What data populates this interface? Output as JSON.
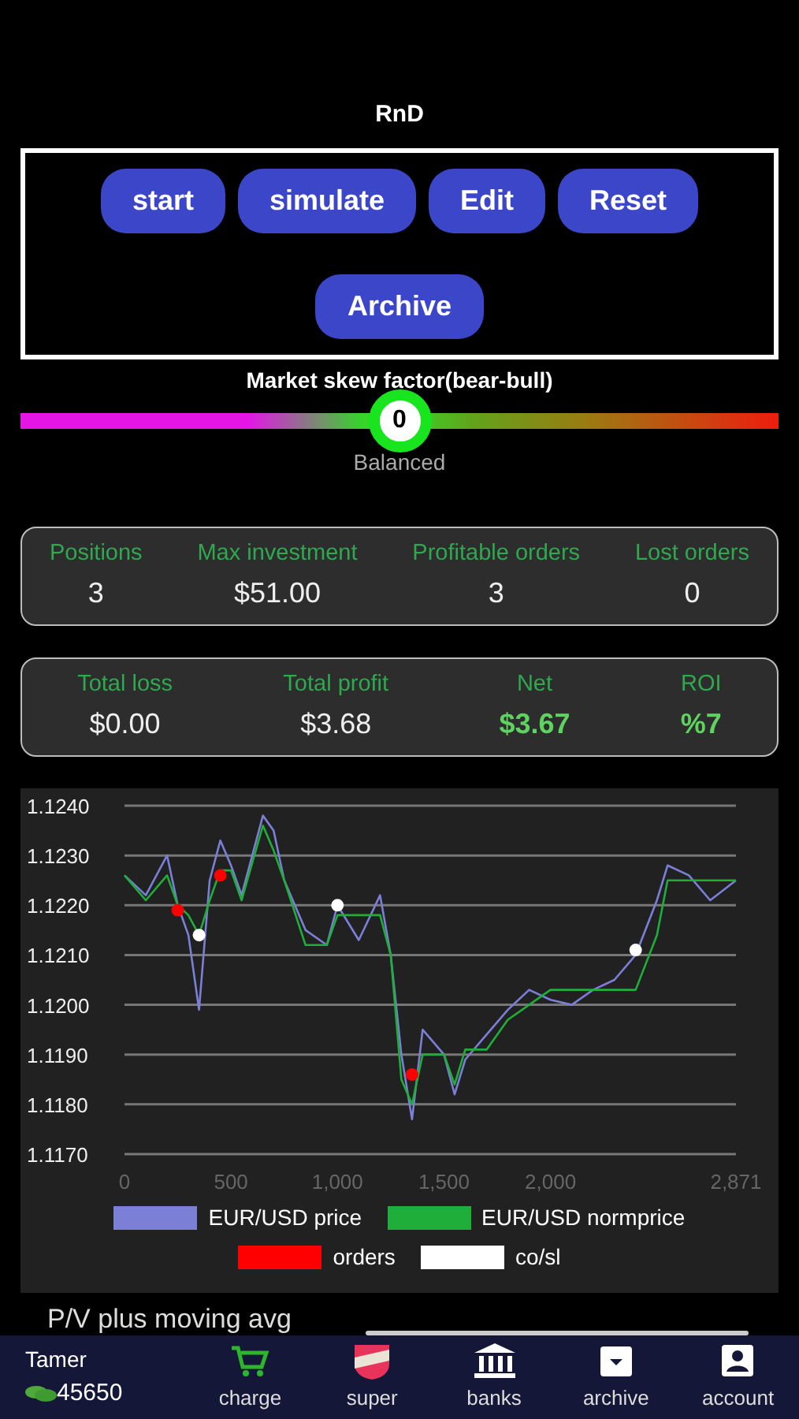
{
  "title": "RnD",
  "buttons": [
    {
      "label": "start"
    },
    {
      "label": "simulate"
    },
    {
      "label": "Edit"
    },
    {
      "label": "Reset"
    },
    {
      "label": "Archive"
    }
  ],
  "skew": {
    "label": "Market skew factor(bear-bull)",
    "value": "0",
    "level": 0.5,
    "caption": "Balanced"
  },
  "stats_1": [
    {
      "label": "Positions",
      "value": "3",
      "highlight": false
    },
    {
      "label": "Max investment",
      "value": "$51.00",
      "highlight": false
    },
    {
      "label": "Profitable orders",
      "value": "3",
      "highlight": false
    },
    {
      "label": "Lost orders",
      "value": "0",
      "highlight": false
    }
  ],
  "stats_2": [
    {
      "label": "Total loss",
      "value": "$0.00",
      "highlight": false
    },
    {
      "label": "Total profit",
      "value": "$3.68",
      "highlight": false
    },
    {
      "label": "Net",
      "value": "$3.67",
      "highlight": true
    },
    {
      "label": "ROI",
      "value": "%7",
      "highlight": true
    }
  ],
  "chart_data": {
    "type": "line",
    "x": [
      0,
      100,
      200,
      250,
      300,
      350,
      400,
      450,
      500,
      550,
      650,
      700,
      750,
      850,
      950,
      1000,
      1100,
      1200,
      1250,
      1300,
      1350,
      1400,
      1500,
      1550,
      1600,
      1700,
      1800,
      1900,
      2000,
      2100,
      2200,
      2300,
      2400,
      2500,
      2550,
      2650,
      2750,
      2871
    ],
    "series": [
      {
        "name": "EUR/USD price",
        "color": "#7b7fd6",
        "values": [
          1.1226,
          1.1222,
          1.123,
          1.122,
          1.1214,
          1.1199,
          1.1225,
          1.1233,
          1.1228,
          1.1222,
          1.1238,
          1.1235,
          1.1225,
          1.1215,
          1.1212,
          1.122,
          1.1213,
          1.1222,
          1.121,
          1.119,
          1.1177,
          1.1195,
          1.119,
          1.1182,
          1.1189,
          1.1194,
          1.1199,
          1.1203,
          1.1201,
          1.12,
          1.1203,
          1.1205,
          1.121,
          1.1221,
          1.1228,
          1.1226,
          1.1221,
          1.1225
        ]
      },
      {
        "name": "EUR/USD normprice",
        "color": "#1fae3a",
        "values": [
          1.1226,
          1.1221,
          1.1226,
          1.122,
          1.1218,
          1.1214,
          1.1221,
          1.1227,
          1.1227,
          1.1221,
          1.1236,
          1.1231,
          1.1225,
          1.1212,
          1.1212,
          1.1218,
          1.1218,
          1.1218,
          1.121,
          1.1185,
          1.118,
          1.119,
          1.119,
          1.1184,
          1.1191,
          1.1191,
          1.1197,
          1.12,
          1.1203,
          1.1203,
          1.1203,
          1.1203,
          1.1203,
          1.1214,
          1.1225,
          1.1225,
          1.1225,
          1.1225
        ]
      },
      {
        "name": "orders",
        "color": "#ff0000",
        "type": "scatter",
        "values": [
          null,
          null,
          null,
          1.1219,
          null,
          null,
          null,
          1.1226,
          null,
          null,
          null,
          null,
          null,
          null,
          null,
          null,
          null,
          null,
          null,
          null,
          1.1186,
          null,
          null,
          null,
          null,
          null,
          null,
          null,
          null,
          null,
          null,
          null,
          null,
          null,
          null,
          null,
          null,
          null
        ]
      },
      {
        "name": "co/sl",
        "color": "#ffffff",
        "type": "scatter",
        "values": [
          null,
          null,
          null,
          null,
          null,
          1.1214,
          null,
          null,
          null,
          null,
          null,
          null,
          null,
          null,
          null,
          1.122,
          null,
          null,
          null,
          null,
          null,
          null,
          null,
          null,
          null,
          null,
          null,
          null,
          null,
          null,
          null,
          null,
          1.1211,
          null,
          null,
          null,
          null,
          null
        ]
      }
    ],
    "grid": true,
    "legend": true,
    "xlim": [
      0,
      2871
    ],
    "ylim": [
      1.117,
      1.124
    ],
    "xticks": [
      0,
      500,
      {
        "value": 1000,
        "label": "1,000"
      },
      {
        "value": 1500,
        "label": "1,500"
      },
      {
        "value": 2000,
        "label": "2,000"
      },
      {
        "value": 2871,
        "label": "2,871"
      }
    ],
    "yticks": [
      {
        "value": 1.117,
        "label": "1.1170"
      },
      {
        "value": 1.118,
        "label": "1.1180"
      },
      {
        "value": 1.119,
        "label": "1.1190"
      },
      {
        "value": 1.12,
        "label": "1.1200"
      },
      {
        "value": 1.121,
        "label": "1.1210"
      },
      {
        "value": 1.122,
        "label": "1.1220"
      },
      {
        "value": 1.123,
        "label": "1.1230"
      },
      {
        "value": 1.124,
        "label": "1.1240"
      }
    ]
  },
  "next_section": {
    "label": "P/V plus moving avg"
  },
  "user": {
    "name": "Tamer",
    "coins": "45650"
  },
  "nav": [
    {
      "label": "charge"
    },
    {
      "label": "super"
    },
    {
      "label": "banks"
    },
    {
      "label": "archive"
    },
    {
      "label": "account"
    }
  ]
}
